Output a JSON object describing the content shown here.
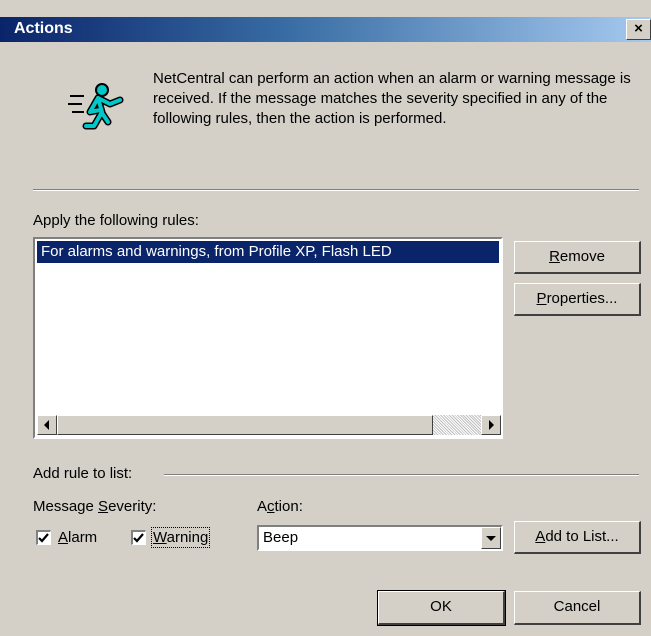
{
  "window": {
    "title": "Actions",
    "close_glyph": "×"
  },
  "intro": {
    "icon": "running-person-icon",
    "text": "NetCentral can perform an action when an alarm or warning message is received. If the message matches the severity specified in any of the following rules, then the action is performed."
  },
  "rules": {
    "label": "Apply the following rules:",
    "items": [
      "For alarms and warnings, from Profile XP, Flash LED"
    ],
    "selected_index": 0
  },
  "buttons": {
    "remove": {
      "prefix": "",
      "access": "R",
      "rest": "emove"
    },
    "properties": {
      "prefix": "",
      "access": "P",
      "rest": "roperties..."
    },
    "add_to_list": {
      "prefix": "",
      "access": "A",
      "rest": "dd to List..."
    },
    "ok": "OK",
    "cancel": "Cancel"
  },
  "add_rule": {
    "section_label": "Add rule to list:",
    "severity_label": {
      "prefix": "Message ",
      "access": "S",
      "rest": "everity:"
    },
    "alarm": {
      "prefix": "",
      "access": "A",
      "rest": "larm",
      "checked": true
    },
    "warning": {
      "prefix": "",
      "access": "W",
      "rest": "arning",
      "checked": true
    },
    "action_label": {
      "prefix": "A",
      "access": "c",
      "rest": "tion:"
    },
    "action_value": "Beep"
  },
  "colors": {
    "title_bar_start": "#0a246a",
    "title_bar_end": "#a6caf0",
    "selection": "#0a246a",
    "face": "#d4d0c8",
    "icon_fill": "#00c8c8"
  }
}
